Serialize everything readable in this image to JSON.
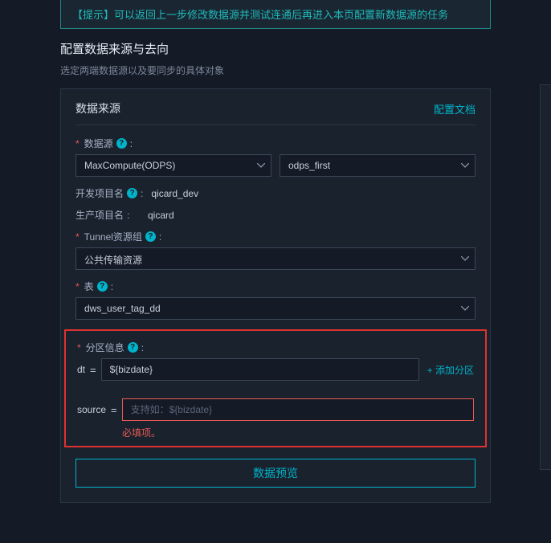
{
  "tip": "【提示】可以返回上一步修改数据源并测试连通后再进入本页配置新数据源的任务",
  "section": {
    "title": "配置数据来源与去向",
    "sub": "选定两端数据源以及要同步的具体对象"
  },
  "panel": {
    "title": "数据来源",
    "doc_link": "配置文档"
  },
  "form": {
    "datasource_label": "数据源",
    "datasource_value": "MaxCompute(ODPS)",
    "datasource_name": "odps_first",
    "dev_proj_label": "开发项目名",
    "dev_proj_value": "qicard_dev",
    "prod_proj_label": "生产项目名",
    "prod_proj_value": "qicard",
    "tunnel_label": "Tunnel资源组",
    "tunnel_value": "公共传输资源",
    "table_label": "表",
    "table_value": "dws_user_tag_dd",
    "partition_label": "分区信息",
    "partitions": {
      "p1_key": "dt",
      "p1_val": "${bizdate}",
      "p2_key": "source",
      "p2_placeholder": "支持如：${bizdate}"
    },
    "add_partition": "+ 添加分区",
    "err_required": "必填项。",
    "preview_button": "数据预览"
  }
}
